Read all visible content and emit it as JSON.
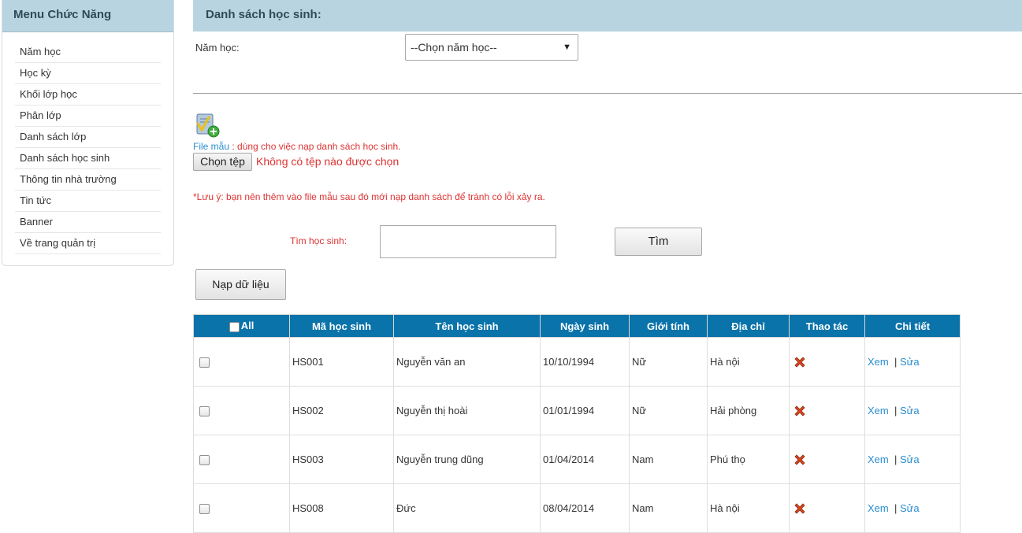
{
  "sidebar": {
    "title": "Menu Chức Năng",
    "items": [
      {
        "label": "Năm học"
      },
      {
        "label": "Học kỳ"
      },
      {
        "label": "Khối lớp học"
      },
      {
        "label": "Phân lớp"
      },
      {
        "label": "Danh sách lớp"
      },
      {
        "label": "Danh sách học sinh"
      },
      {
        "label": "Thông tin nhà trường"
      },
      {
        "label": "Tin tức"
      },
      {
        "label": "Banner"
      },
      {
        "label": "Về trang quản trị"
      }
    ]
  },
  "main": {
    "title": "Danh sách học sinh:",
    "year_label": "Năm học:",
    "year_select_value": "--Chọn năm học--",
    "file_template_link": "File mẫu",
    "file_template_desc": " : dùng cho việc nạp danh sách học sinh.",
    "choose_file_label": "Chọn tệp",
    "no_file_text": "Không có tệp nào được chọn",
    "note": "*Lưu ý: bạn nên thêm vào file mẫu sau đó mới nạp danh sách để tránh có lỗi xảy ra.",
    "search_label": "Tìm học sinh:",
    "search_value": "",
    "search_button": "Tìm",
    "load_button": "Nạp dữ liệu"
  },
  "table": {
    "headers": {
      "all": "All",
      "code": "Mã học sinh",
      "name": "Tên học sinh",
      "dob": "Ngày sinh",
      "gender": "Giới tính",
      "address": "Địa chỉ",
      "action": "Thao tác",
      "detail": "Chi tiết"
    },
    "view_label": "Xem",
    "separator": "|",
    "edit_label": "Sửa",
    "rows": [
      {
        "code": "HS001",
        "name": "Nguyễn văn an",
        "dob": "10/10/1994",
        "gender": "Nữ",
        "address": "Hà nội"
      },
      {
        "code": "HS002",
        "name": "Nguyễn thị hoài",
        "dob": "01/01/1994",
        "gender": "Nữ",
        "address": "Hải phòng"
      },
      {
        "code": "HS003",
        "name": "Nguyễn trung dũng",
        "dob": "01/04/2014",
        "gender": "Nam",
        "address": "Phú thọ"
      },
      {
        "code": "HS008",
        "name": "Đức",
        "dob": "08/04/2014",
        "gender": "Nam",
        "address": "Hà nội"
      }
    ]
  },
  "colors": {
    "header_bg": "#b8d4e0",
    "table_header_bg": "#0a73aa",
    "link": "#2a8dd0",
    "warning_text": "#dd3333"
  }
}
